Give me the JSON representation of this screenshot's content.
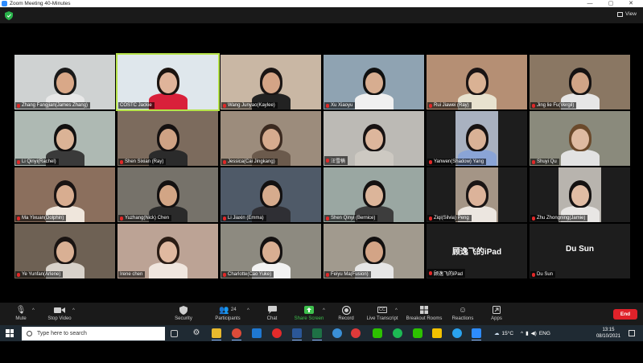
{
  "window": {
    "title": "Zoom Meeting 40-Minutes",
    "controls": [
      "—",
      "▢",
      "✕"
    ]
  },
  "topbar": {
    "view_label": "View"
  },
  "participants": [
    {
      "name": "Zhang Fangjian(James Zhang)",
      "muted": true,
      "bg": "#cfd2d2",
      "skin": "#d9a888",
      "hair": "#1a1a1a",
      "shirt": "#e8e8e8"
    },
    {
      "name": "COSTC Jackie",
      "muted": false,
      "active": true,
      "bg": "#dfe7ec",
      "skin": "#e0b49a",
      "hair": "#1b1410",
      "shirt": "#d9203a"
    },
    {
      "name": "Wang Junyao(Kaylee)",
      "muted": true,
      "bg": "#c9b7a4",
      "skin": "#d4a486",
      "hair": "#1a1514",
      "shirt": "#222222"
    },
    {
      "name": "Xu Xiaoyu",
      "muted": true,
      "bg": "#8fa3b2",
      "skin": "#d7ad90",
      "hair": "#101010",
      "shirt": "#f0f0f0"
    },
    {
      "name": "Rui Jiawei (Ray)",
      "muted": true,
      "bg": "#b58f74",
      "skin": "#dab294",
      "hair": "#1a1414",
      "shirt": "#e8e2cf"
    },
    {
      "name": "Jing lie Fu(Vergil)",
      "muted": true,
      "bg": "#8a7763",
      "skin": "#d0a486",
      "hair": "#151212",
      "shirt": "#e6e6e6"
    },
    {
      "name": "Li Qinyi(Rachel)",
      "muted": true,
      "bg": "#aeb9b3",
      "skin": "#dbb396",
      "hair": "#121010",
      "shirt": "#3a3a3a"
    },
    {
      "name": "Shen Sixian (Ray)",
      "muted": true,
      "bg": "#7c6b5d",
      "skin": "#cfa284",
      "hair": "#151111",
      "shirt": "#2b2b2b"
    },
    {
      "name": "Jessica(Cai Jingkang)",
      "muted": true,
      "bg": "#9c8c7c",
      "skin": "#d6ab8e",
      "hair": "#3b2a20",
      "shirt": "#6b5a4c"
    },
    {
      "name": "汪雪楠",
      "muted": true,
      "bg": "#bcbab5",
      "skin": "#ddb69c",
      "hair": "#181313",
      "shirt": "#cdc9c2"
    },
    {
      "name": "Yanwen(Shadow) Yang",
      "muted": true,
      "bg": "#a9b1c0",
      "skin": "#d9b196",
      "hair": "#171212",
      "shirt": "#8aa4d6",
      "narrow": true
    },
    {
      "name": "Shuyi Qu",
      "muted": true,
      "bg": "#8a8a7c",
      "skin": "#dfbba2",
      "hair": "#6b4a2c",
      "shirt": "#e2e2e2"
    },
    {
      "name": "Ma Yixuan(Dolphin)",
      "muted": true,
      "bg": "#8b6f5d",
      "skin": "#d8ad90",
      "hair": "#1a1413",
      "shirt": "#efe6dc"
    },
    {
      "name": "Yuzhang(Nick) Chen",
      "muted": true,
      "bg": "#76726a",
      "skin": "#d2a585",
      "hair": "#131010",
      "shirt": "#2a2a2a"
    },
    {
      "name": "Li Jiaxin (Emma)",
      "muted": true,
      "bg": "#4f5a68",
      "skin": "#d6ab8d",
      "hair": "#121010",
      "shirt": "#2f2f34"
    },
    {
      "name": "Shen Qinyi (Bernice)",
      "muted": true,
      "bg": "#9aa7a2",
      "skin": "#dcb59a",
      "hair": "#141111",
      "shirt": "#3d3d3d"
    },
    {
      "name": "Ziqi(Silvia) Peng",
      "muted": true,
      "bg": "#a49586",
      "skin": "#dcb39a",
      "hair": "#1a1515",
      "shirt": "#ece6e0",
      "narrow": true
    },
    {
      "name": "Zhu Zhongning(Jamie)",
      "muted": true,
      "bg": "#b8b4ae",
      "skin": "#e0bca4",
      "hair": "#151212",
      "shirt": "#e8e6e4",
      "narrow": true
    },
    {
      "name": "Ye Yunfan(Arlene)",
      "muted": true,
      "bg": "#6e6154",
      "skin": "#d9b094",
      "hair": "#1a1412",
      "shirt": "#d8d2ca"
    },
    {
      "name": "Irene chen",
      "muted": false,
      "bg": "#bca395",
      "skin": "#e0b9a0",
      "hair": "#2a1c14",
      "shirt": "#f0e6de"
    },
    {
      "name": "Charlotte(Cao Yuke)",
      "muted": true,
      "bg": "#8d8a80",
      "skin": "#d8ae92",
      "hair": "#141111",
      "shirt": "#f2f2f2"
    },
    {
      "name": "Feiyu Ma(Fusion)",
      "muted": true,
      "bg": "#a19a8e",
      "skin": "#d3a486",
      "hair": "#121010",
      "shirt": "#e6e6e6"
    },
    {
      "name": "顾逸飞的iPad",
      "muted": true,
      "noimg": true,
      "big": "顾逸飞的iPad"
    },
    {
      "name": "Du Sun",
      "muted": true,
      "noimg": true,
      "big": "Du Sun"
    }
  ],
  "toolbar": {
    "mute": "Mute",
    "stop_video": "Stop Video",
    "security": "Security",
    "participants": "Participants",
    "participants_count": "24",
    "chat": "Chat",
    "share_screen": "Share Screen",
    "record": "Record",
    "cc_badge": "CC",
    "live_transcript": "Live Transcript",
    "breakout_rooms": "Breakout Rooms",
    "reactions": "Reactions",
    "apps": "Apps",
    "end": "End"
  },
  "taskbar": {
    "search_placeholder": "Type here to search",
    "weather": "15°C",
    "language": "ENG",
    "time": "13:15",
    "date": "08/10/2021"
  },
  "colors": {
    "active_speaker_border": "#b6e34a",
    "end_button": "#e0222a",
    "share_green": "#3ec04d",
    "mic_muted": "#e02828"
  }
}
